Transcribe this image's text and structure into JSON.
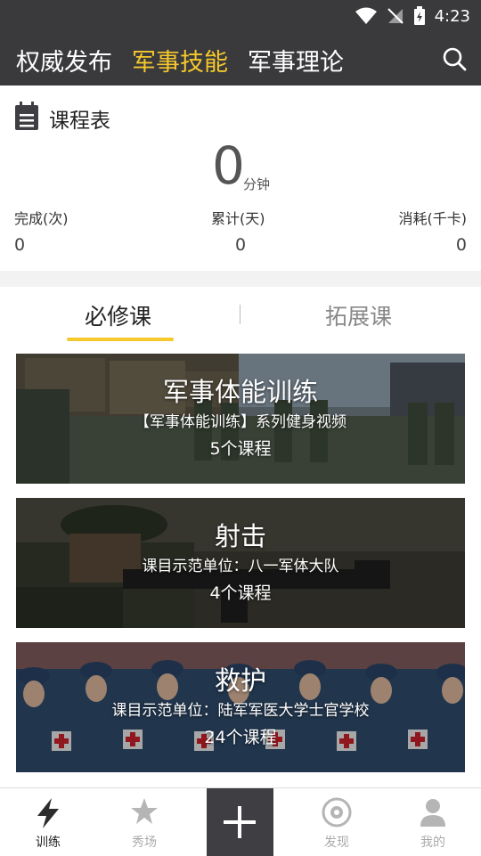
{
  "status_bar": {
    "time": "4:23"
  },
  "top_tabs": [
    {
      "label": "权威发布",
      "active": false
    },
    {
      "label": "军事技能",
      "active": true
    },
    {
      "label": "军事理论",
      "active": false
    }
  ],
  "schedule": {
    "title": "课程表",
    "total_minutes": "0",
    "minutes_unit": "分钟",
    "stats": [
      {
        "label": "完成(次)",
        "value": "0"
      },
      {
        "label": "累计(天)",
        "value": "0"
      },
      {
        "label": "消耗(千卡)",
        "value": "0"
      }
    ]
  },
  "course_tabs": [
    {
      "label": "必修课",
      "active": true
    },
    {
      "label": "拓展课",
      "active": false
    }
  ],
  "courses": [
    {
      "title": "军事体能训练",
      "subtitle": "【军事体能训练】系列健身视频",
      "count": "5个课程"
    },
    {
      "title": "射击",
      "subtitle": "课目示范单位：八一军体大队",
      "count": "4个课程"
    },
    {
      "title": "救护",
      "subtitle": "课目示范单位：陆军军医大学士官学校",
      "count": "24个课程"
    }
  ],
  "bottom_nav": [
    {
      "label": "训练",
      "active": true,
      "icon": "lightning-icon"
    },
    {
      "label": "秀场",
      "active": false,
      "icon": "star-icon"
    },
    {
      "label": "",
      "active": false,
      "icon": "plus-icon"
    },
    {
      "label": "发现",
      "active": false,
      "icon": "discover-icon"
    },
    {
      "label": "我的",
      "active": false,
      "icon": "user-icon"
    }
  ],
  "colors": {
    "accent": "#f5c82c",
    "header_bg": "#3a3a3d"
  }
}
